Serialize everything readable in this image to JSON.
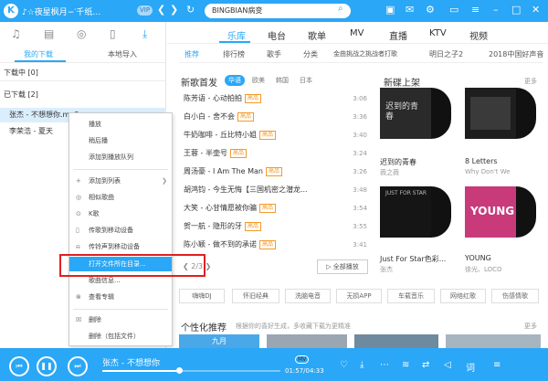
{
  "app": {
    "logo": "K",
    "username": "♪☆夜星枫月−′千纸…",
    "vip": "VIP",
    "search_value": "BINGBIAN病变"
  },
  "sidebar": {
    "tabs": [
      "我的下载",
      "本地导入"
    ],
    "downloading": "下载中 [0]",
    "downloaded": "已下载 [2]",
    "songs": [
      "张杰 - 不想想你.mp3",
      "李荣浩 - 夏天"
    ]
  },
  "context_menu": {
    "items": [
      "播放",
      "稍后播",
      "添加到播放队列",
      "添加到列表",
      "相似歌曲",
      "K歌",
      "传歌到移动设备",
      "传铃声到移动设备",
      "打开文件所在目录...",
      "歌曲信息...",
      "查看专辑",
      "删除",
      "删除（包括文件）"
    ]
  },
  "main_tabs": [
    "乐库",
    "电台",
    "歌单",
    "MV",
    "直播",
    "KTV",
    "视频"
  ],
  "sub_tabs": [
    "推荐",
    "排行榜",
    "歌手",
    "分类",
    "金曲挑战之挑战者打歌",
    "明日之子2",
    "2018中国好声音"
  ],
  "new_songs": {
    "title": "新歌首发",
    "filters": [
      "华语",
      "欧美",
      "韩国",
      "日本"
    ],
    "list": [
      {
        "name": "陈芳语 - 心动拍拍",
        "tag": "高品",
        "dur": "3:06"
      },
      {
        "name": "白小白 - 舍不会",
        "tag": "高品",
        "dur": "3:36"
      },
      {
        "name": "牛奶咖啡 - 丘比特小姐",
        "tag": "高品",
        "dur": "3:40"
      },
      {
        "name": "王蓉 - 半壶号",
        "tag": "高品",
        "dur": "3:24"
      },
      {
        "name": "周汤豪 - I Am The Man",
        "tag": "高品",
        "dur": "3:26"
      },
      {
        "name": "胡鸿钧 - 今生无悔【三国机密之潜龙...",
        "tag": "",
        "dur": "3:48"
      },
      {
        "name": "大笑 - 心甘情愿被你骗",
        "tag": "高品",
        "dur": "3:54"
      },
      {
        "name": "贺一航 - 隐形的牙",
        "tag": "高品",
        "dur": "3:55"
      },
      {
        "name": "陈小颖 - 做不到的承诺",
        "tag": "高品",
        "dur": "3:41"
      }
    ],
    "pager": "2/3",
    "play_all": "▷ 全部播放"
  },
  "new_albums": {
    "title": "新碟上架",
    "more": "更多",
    "albums": [
      {
        "title": "迟到的青春",
        "artist": "薇之薇",
        "cover": "#2a2a2a",
        "cover_text": "迟到的青春"
      },
      {
        "title": "8 Letters",
        "artist": "Why Don't We",
        "cover": "#1e1e1e",
        "cover_text": ""
      },
      {
        "title": "Just For Star色彩...",
        "artist": "张杰",
        "cover": "#151515",
        "cover_text": "JUST FOR STAR"
      },
      {
        "title": "YOUNG",
        "artist": "徐光、LOCO",
        "cover": "#c83a7a",
        "cover_text": "YOUNG"
      }
    ]
  },
  "tags": [
    "嗨嗨DJ",
    "怀旧经典",
    "洗脑电音",
    "无损APP",
    "车载音乐",
    "网络红歌",
    "伤感情歌"
  ],
  "personal": {
    "title": "个性化推荐",
    "subtitle": "根据你的喜好生成，多收藏下载为更精准",
    "more": "更多",
    "banner_text": "九月"
  },
  "player": {
    "title": "张杰 - 不想想你",
    "mv": "MV",
    "time": "01:57/04:33",
    "progress": 0.43
  },
  "colors": {
    "accent": "#2aa7f6",
    "highlight": "#e02020",
    "tag": "#f39b2a"
  }
}
